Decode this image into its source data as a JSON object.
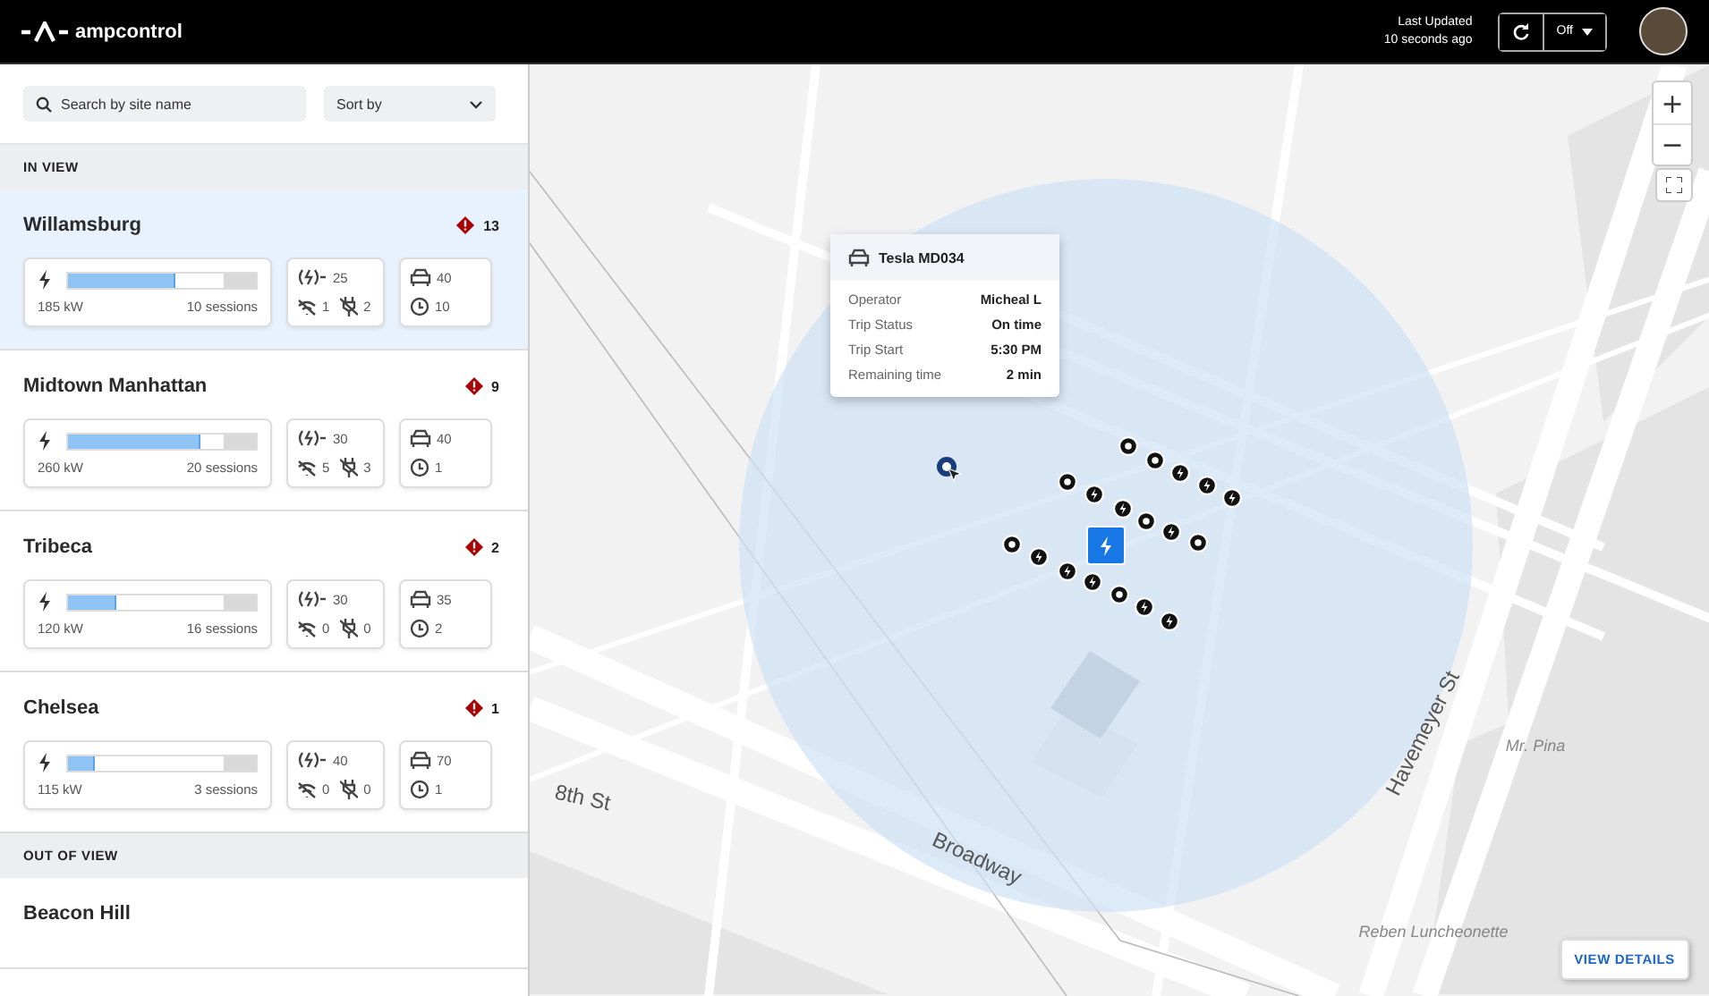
{
  "header": {
    "logo": "ampcontrol",
    "last_updated_label": "Last Updated",
    "last_updated_value": "10 seconds ago",
    "auto_refresh": "Off"
  },
  "sidebar": {
    "search": {
      "placeholder": "Search by site name"
    },
    "sort": {
      "label": "Sort by"
    },
    "sections": [
      {
        "title": "IN VIEW",
        "sites": [
          {
            "name": "Willamsburg",
            "selected": true,
            "alerts": "13",
            "level": 0.57,
            "power": "185 kW",
            "sessions": "10 sessions",
            "chargers": "25",
            "offline": "1",
            "faults": "2",
            "vehicles": "40",
            "waiting": "10"
          },
          {
            "name": "Midtown Manhattan",
            "selected": false,
            "alerts": "9",
            "level": 0.7,
            "power": "260 kW",
            "sessions": "20 sessions",
            "chargers": "30",
            "offline": "5",
            "faults": "3",
            "vehicles": "40",
            "waiting": "1"
          },
          {
            "name": "Tribeca",
            "selected": false,
            "alerts": "2",
            "level": 0.26,
            "power": "120 kW",
            "sessions": "16 sessions",
            "chargers": "30",
            "offline": "0",
            "faults": "0",
            "vehicles": "35",
            "waiting": "2"
          },
          {
            "name": "Chelsea",
            "selected": false,
            "alerts": "1",
            "level": 0.14,
            "power": "115 kW",
            "sessions": "3 sessions",
            "chargers": "40",
            "offline": "0",
            "faults": "0",
            "vehicles": "70",
            "waiting": "1"
          }
        ]
      },
      {
        "title": "OUT OF VIEW",
        "sites": [
          {
            "name": "Beacon Hill",
            "selected": false
          }
        ]
      }
    ]
  },
  "map": {
    "zoom_in": "+",
    "zoom_out": "−",
    "tooltip": {
      "title": "Tesla MD034",
      "rows": [
        {
          "label": "Operator",
          "value": "Micheal L"
        },
        {
          "label": "Trip Status",
          "value": "On time"
        },
        {
          "label": "Trip Start",
          "value": "5:30 PM"
        },
        {
          "label": "Remaining time",
          "value": "2 min"
        }
      ]
    },
    "labels": [
      {
        "text": "8th St",
        "kind": "street"
      },
      {
        "text": "Broadway",
        "kind": "street"
      },
      {
        "text": "Havemeyer St",
        "kind": "street"
      },
      {
        "text": "Mr. Pina",
        "kind": "place"
      },
      {
        "text": "Reben Luncheonette",
        "kind": "place"
      }
    ],
    "markers": [
      {
        "kind": "idle"
      },
      {
        "kind": "idle"
      },
      {
        "kind": "charging"
      },
      {
        "kind": "charging"
      },
      {
        "kind": "charging"
      },
      {
        "kind": "idle"
      },
      {
        "kind": "charging"
      },
      {
        "kind": "charging"
      },
      {
        "kind": "idle"
      },
      {
        "kind": "charging"
      },
      {
        "kind": "idle"
      },
      {
        "kind": "idle"
      },
      {
        "kind": "charging"
      },
      {
        "kind": "charging"
      },
      {
        "kind": "charging"
      },
      {
        "kind": "idle"
      },
      {
        "kind": "charging"
      },
      {
        "kind": "charging"
      }
    ],
    "view_details": "VIEW DETAILS"
  }
}
